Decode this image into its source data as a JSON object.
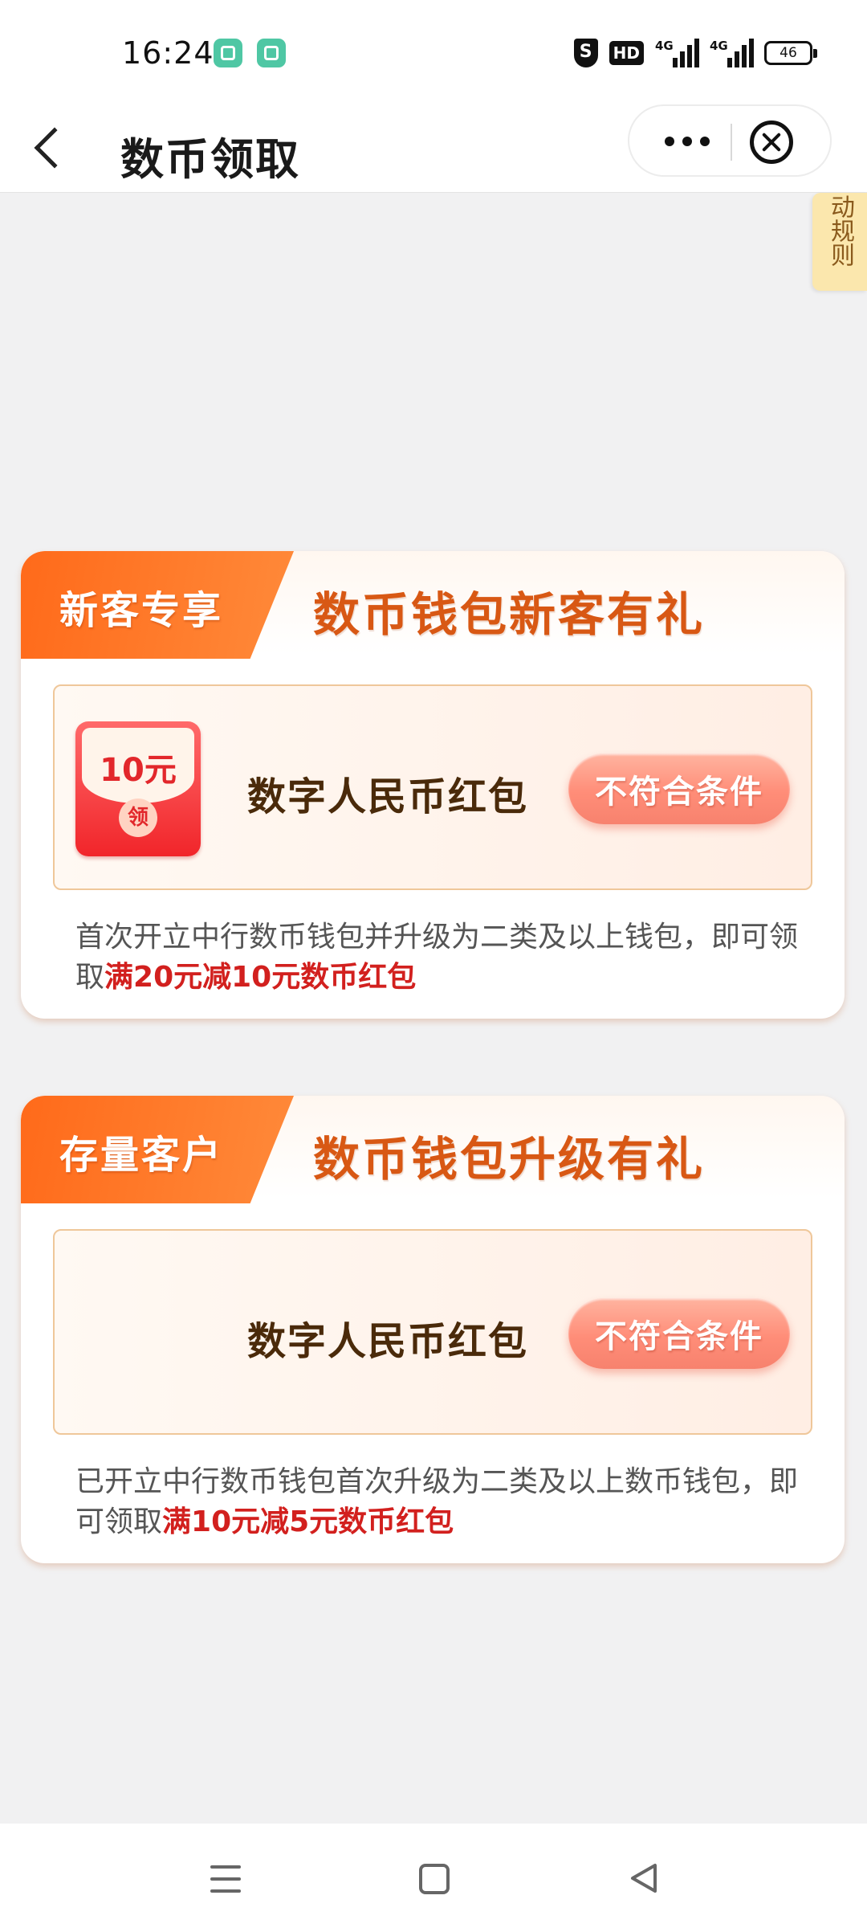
{
  "status_bar": {
    "time": "16:24",
    "shield": "S",
    "hd": "HD",
    "signal_1": "4G",
    "signal_2": "4G",
    "battery": "46"
  },
  "nav": {
    "title": "数币领取"
  },
  "rules_tab": {
    "label": "动规则"
  },
  "cards": [
    {
      "badge": "新客专享",
      "title": "数币钱包新客有礼",
      "envelope_amount": "10元",
      "envelope_seal": "领",
      "offer_name": "数字人民币红包",
      "button": "不符合条件",
      "desc_prefix": "首次开立中行数币钱包并升级为二类及以上钱包，即可领取",
      "desc_highlight": "满20元减10元数币红包"
    },
    {
      "badge": "存量客户",
      "title": "数币钱包升级有礼",
      "offer_name": "数字人民币红包",
      "button": "不符合条件",
      "desc_prefix": "已开立中行数币钱包首次升级为二类及以上数币钱包，即可领取",
      "desc_highlight": "满10元减5元数币红包"
    }
  ],
  "colors": {
    "accent_orange": "#ff6a1a",
    "title_orange": "#d85814",
    "highlight_red": "#d2201e",
    "button_pink": "#ff8d78",
    "page_background": "#f1f1f2"
  },
  "icons": {
    "back": "back-chevron-icon",
    "more": "more-dots-icon",
    "close": "close-circle-icon",
    "sys_menu": "menu-icon",
    "sys_home": "home-square-icon",
    "sys_back": "back-triangle-icon"
  }
}
